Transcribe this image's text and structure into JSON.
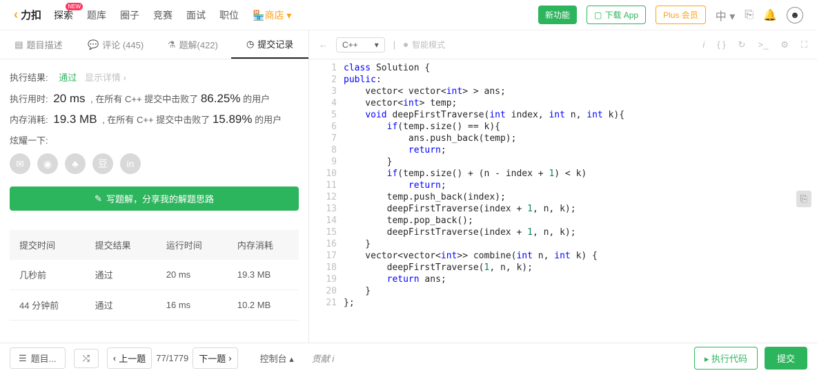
{
  "site": {
    "name": "力扣"
  },
  "nav": {
    "explore": "探索",
    "new_badge": "NEW",
    "problems": "题库",
    "circle": "圈子",
    "contest": "竞赛",
    "interview": "面试",
    "jobs": "职位",
    "shop": "商店"
  },
  "top_right": {
    "new_feature": "新功能",
    "download": "下载 App",
    "plus": "Plus 会员",
    "lang": "中"
  },
  "tabs": {
    "desc": "题目描述",
    "comments": "评论 (445)",
    "solutions": "题解(422)",
    "submissions": "提交记录"
  },
  "result": {
    "label": "执行结果:",
    "status": "通过",
    "show_detail": "显示详情 ›",
    "runtime_label": "执行用时:",
    "runtime": "20 ms",
    "runtime_text": ", 在所有 C++ 提交中击败了",
    "runtime_pct": "86.25%",
    "runtime_users": " 的用户",
    "memory_label": "内存消耗:",
    "memory": "19.3 MB",
    "memory_text": ", 在所有 C++ 提交中击败了",
    "memory_pct": "15.89%",
    "memory_users": " 的用户",
    "share_label": "炫耀一下:",
    "write_solution": "写题解，分享我的解题思路"
  },
  "history": {
    "headers": {
      "time": "提交时间",
      "result": "提交结果",
      "runtime": "运行时间",
      "memory": "内存消耗"
    },
    "rows": [
      {
        "time": "几秒前",
        "result": "通过",
        "runtime": "20 ms",
        "memory": "19.3 MB"
      },
      {
        "time": "44 分钟前",
        "result": "通过",
        "runtime": "16 ms",
        "memory": "10.2 MB"
      }
    ]
  },
  "editor": {
    "language": "C++",
    "smart_mode": "智能模式",
    "lines": [
      "class Solution {",
      "public:",
      "    vector< vector<int> > ans;",
      "    vector<int> temp;",
      "    void deepFirstTraverse(int index, int n, int k){",
      "        if(temp.size() == k){",
      "            ans.push_back(temp);",
      "            return;",
      "        }",
      "        if(temp.size() + (n - index + 1) < k)",
      "            return;",
      "        temp.push_back(index);",
      "        deepFirstTraverse(index + 1, n, k);",
      "        temp.pop_back();",
      "        deepFirstTraverse(index + 1, n, k);",
      "    }",
      "    vector<vector<int>> combine(int n, int k) {",
      "        deepFirstTraverse(1, n, k);",
      "        return ans;",
      "    }",
      "};"
    ]
  },
  "bottom": {
    "problem_list": "题目...",
    "prev": "上一题",
    "page": "77/1779",
    "next": "下一题",
    "console": "控制台",
    "contribute": "贡献",
    "run": "执行代码",
    "submit": "提交"
  }
}
